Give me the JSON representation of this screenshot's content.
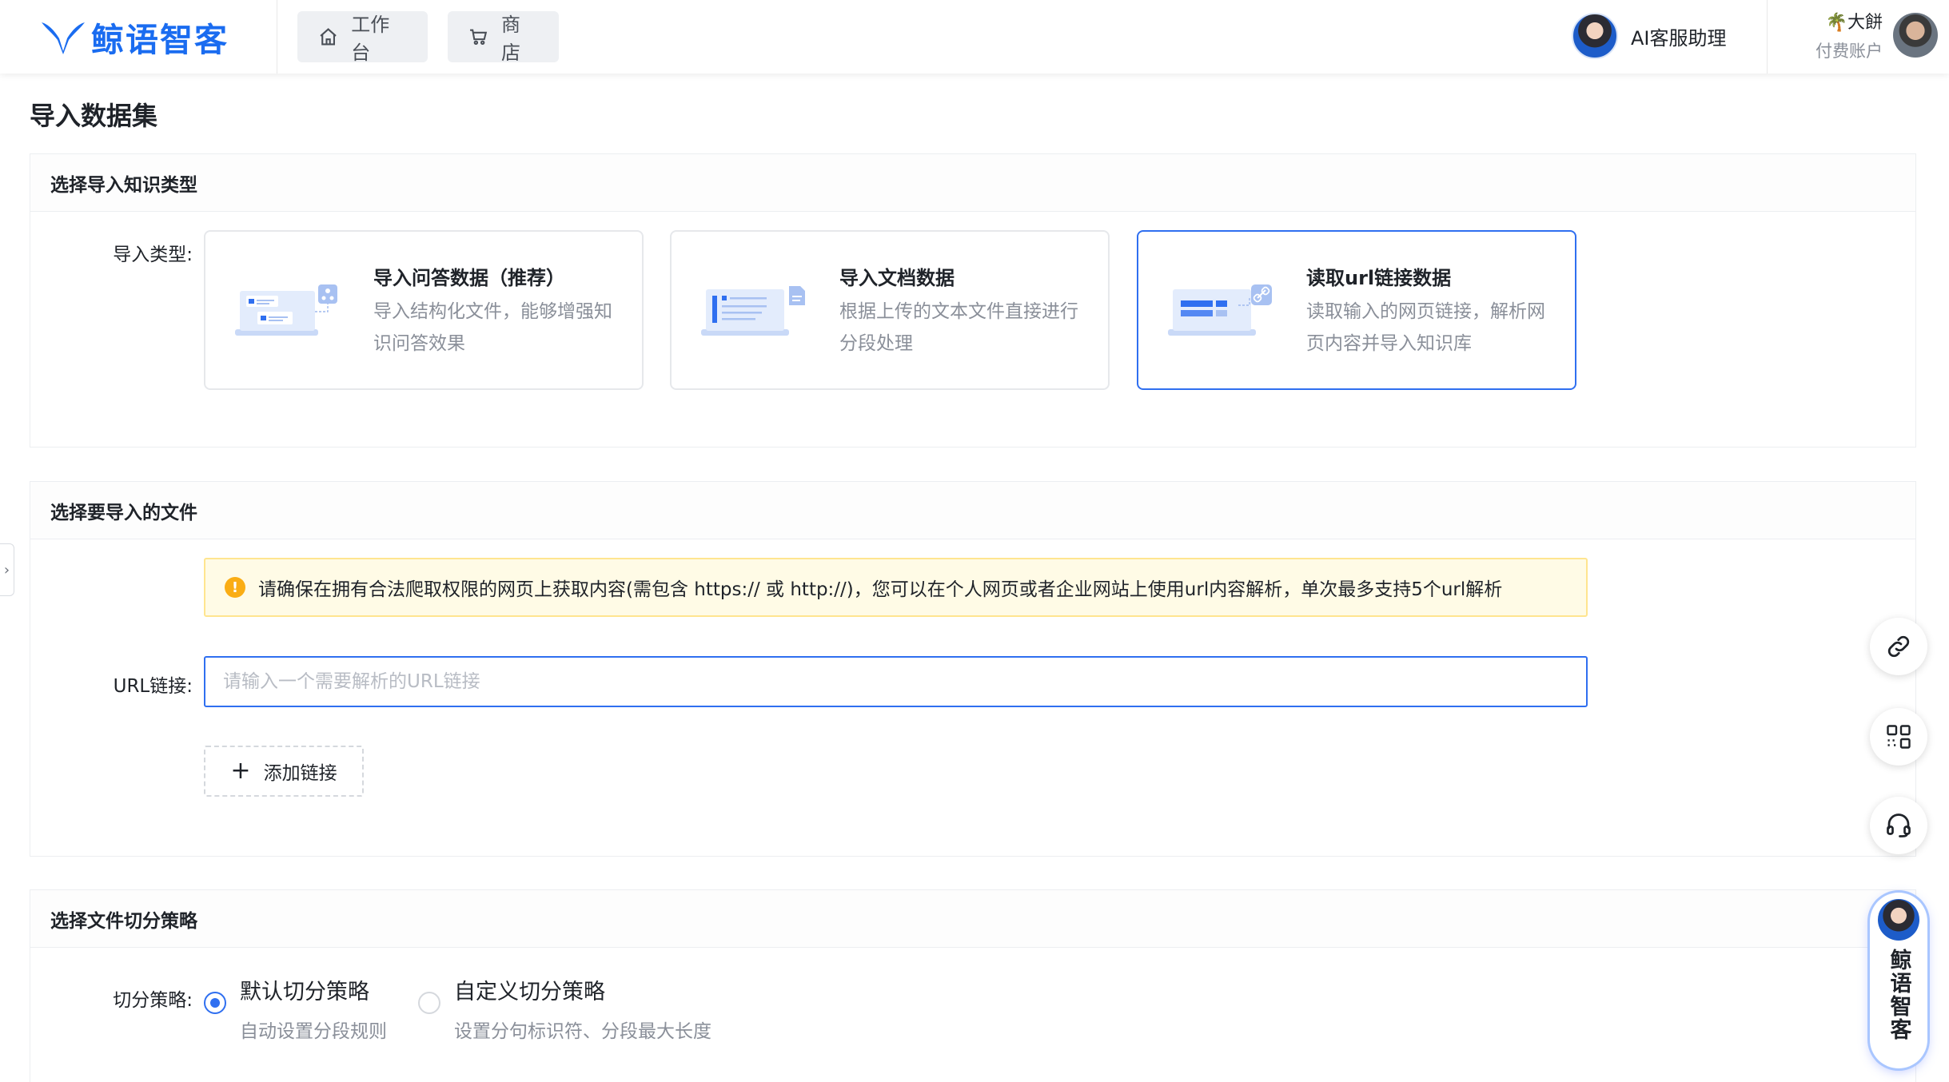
{
  "brand": {
    "name": "鲸语智客",
    "color": "#1a6cf0"
  },
  "nav": {
    "home_label": "工作台",
    "shop_label": "商店"
  },
  "assistant": {
    "label": "AI客服助理"
  },
  "user": {
    "name": "大餅",
    "tier": "付费账户"
  },
  "page": {
    "title": "导入数据集"
  },
  "type_section": {
    "heading": "选择导入知识类型",
    "label": "导入类型:",
    "cards": [
      {
        "title": "导入问答数据（推荐）",
        "desc": "导入结构化文件，能够增强知识问答效果",
        "selected": false
      },
      {
        "title": "导入文档数据",
        "desc": "根据上传的文本文件直接进行分段处理",
        "selected": false
      },
      {
        "title": "读取url链接数据",
        "desc": "读取输入的网页链接，解析网页内容并导入知识库",
        "selected": true
      }
    ]
  },
  "file_section": {
    "heading": "选择要导入的文件",
    "notice": "请确保在拥有合法爬取权限的网页上获取内容(需包含 https:// 或 http://)，您可以在个人网页或者企业网站上使用url内容解析，单次最多支持5个url解析",
    "url_label": "URL链接:",
    "url_value": "",
    "url_placeholder": "请输入一个需要解析的URL链接",
    "add_link_label": "添加链接"
  },
  "strategy_section": {
    "heading": "选择文件切分策略",
    "label": "切分策略:",
    "options": [
      {
        "title": "默认切分策略",
        "desc": "自动设置分段规则",
        "selected": true
      },
      {
        "title": "自定义切分策略",
        "desc": "设置分句标识符、分段最大长度",
        "selected": false
      }
    ]
  },
  "floating": {
    "icons": [
      "link-icon",
      "qrcode-icon",
      "headset-icon"
    ],
    "bot_label": "鲸语智客"
  },
  "colors": {
    "accent": "#2f6ff0",
    "notice_bg": "#fffbe6",
    "notice_border": "#ffe58f",
    "warning": "#faad14"
  }
}
